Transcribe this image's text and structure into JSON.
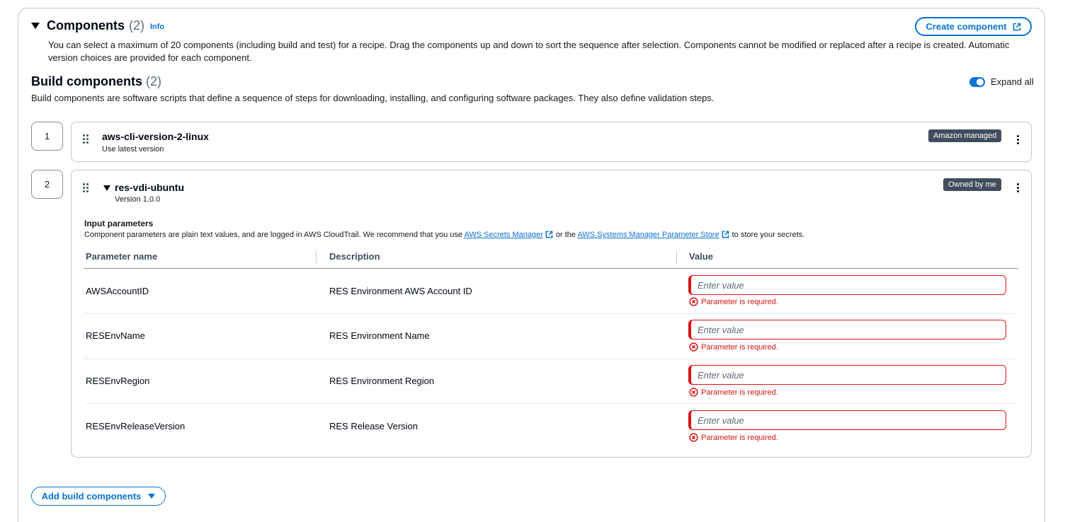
{
  "components": {
    "title": "Components",
    "count": "(2)",
    "info": "Info",
    "create_button": "Create component",
    "description": "You can select a maximum of 20 components (including build and test) for a recipe. Drag the components up and down to sort the sequence after selection. Components cannot be modified or replaced after a recipe is created. Automatic version choices are provided for each component."
  },
  "build": {
    "title": "Build components",
    "count": "(2)",
    "description": "Build components are software scripts that define a sequence of steps for downloading, installing, and configuring software packages. They also define validation steps.",
    "expand_all": "Expand all",
    "expand_all_on": true,
    "items": [
      {
        "index": "1",
        "name": "aws-cli-version-2-linux",
        "subtitle": "Use latest version",
        "badge": "Amazon managed"
      },
      {
        "index": "2",
        "name": "res-vdi-ubuntu",
        "subtitle": "Version 1.0.0",
        "badge": "Owned by me"
      }
    ]
  },
  "input_params": {
    "title": "Input parameters",
    "desc_prefix": "Component parameters are plain text values, and are logged in AWS CloudTrail. We recommend that you use ",
    "link1": "AWS Secrets Manager",
    "desc_middle": "or the ",
    "link2": "AWS Systems Manager Parameter Store",
    "desc_suffix": "to store your secrets.",
    "headers": [
      "Parameter name",
      "Description",
      "Value"
    ],
    "placeholder": "Enter value",
    "error": "Parameter is required.",
    "rows": [
      {
        "name": "AWSAccountID",
        "description": "RES Environment AWS Account ID"
      },
      {
        "name": "RESEnvName",
        "description": "RES Environment Name"
      },
      {
        "name": "RESEnvRegion",
        "description": "RES Environment Region"
      },
      {
        "name": "RESEnvReleaseVersion",
        "description": "RES Release Version"
      }
    ]
  },
  "add_button": "Add build components",
  "colors": {
    "link": "#0972d3",
    "error": "#d91515",
    "badge": "#414d5c"
  }
}
